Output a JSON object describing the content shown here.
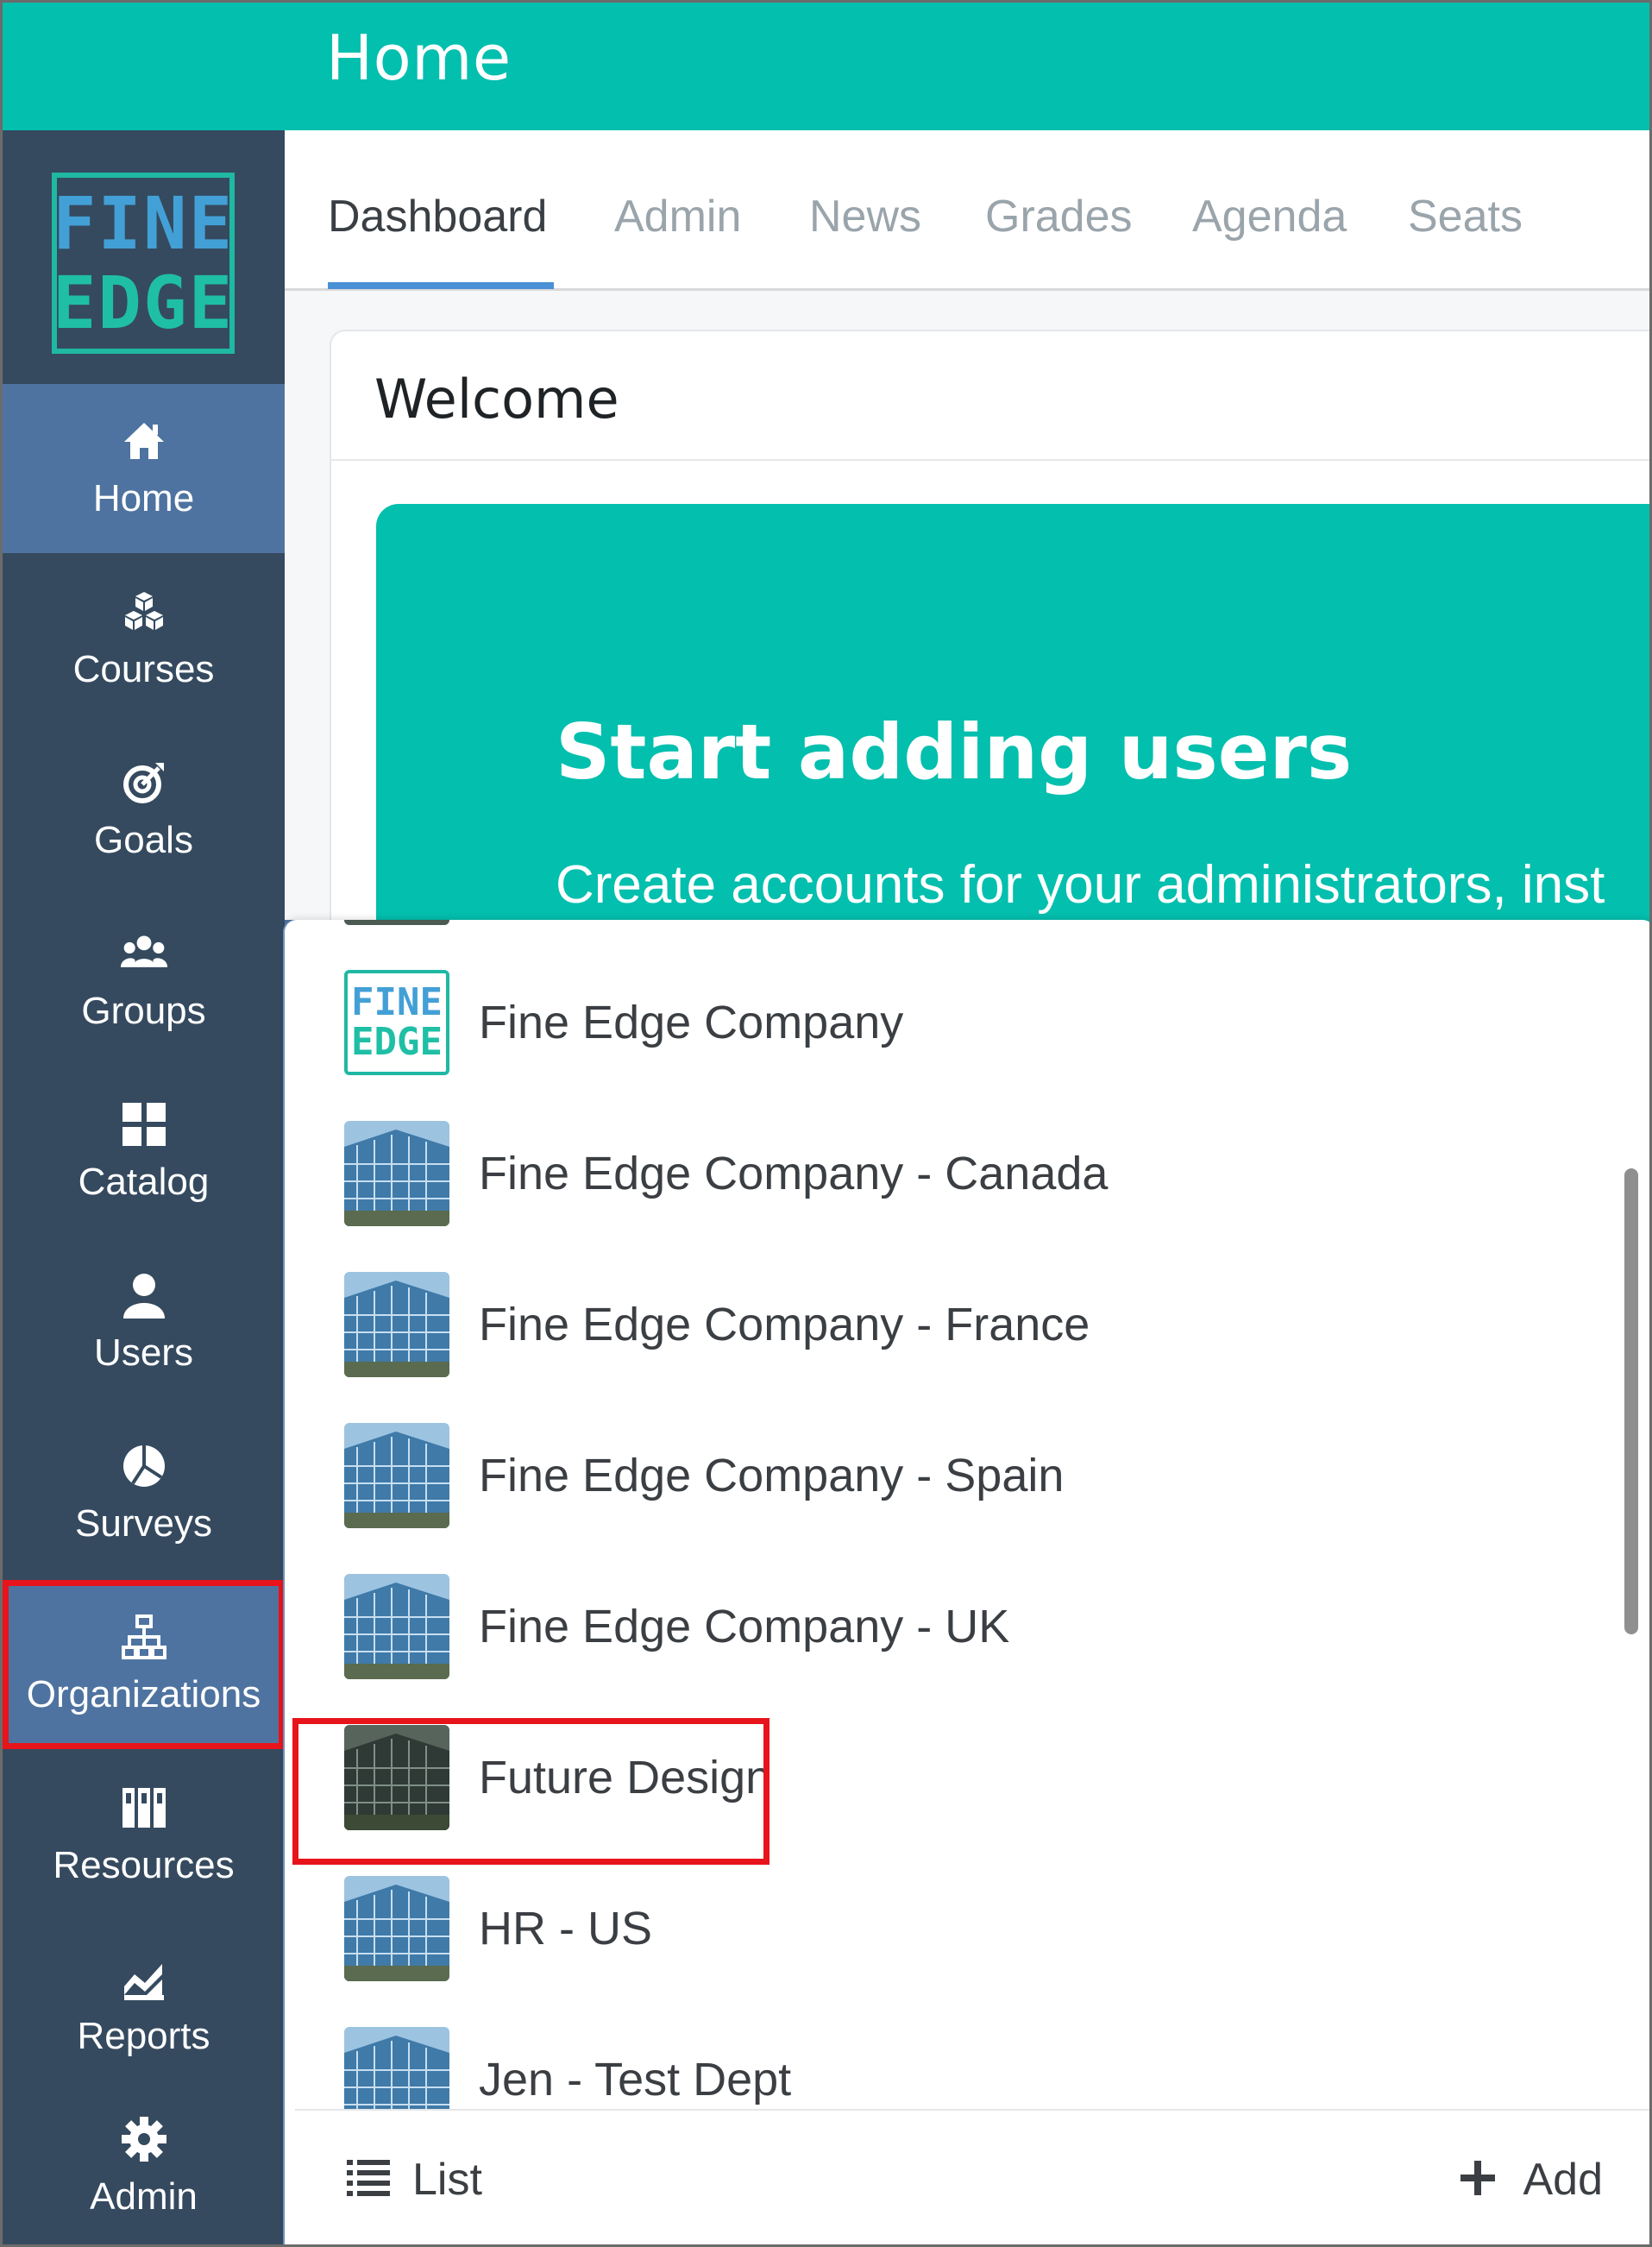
{
  "header": {
    "title": "Home"
  },
  "logo": {
    "line1": "FINE",
    "line2": "EDGE"
  },
  "sidebar": {
    "items": [
      {
        "label": "Home",
        "icon": "home-icon"
      },
      {
        "label": "Courses",
        "icon": "cubes-icon"
      },
      {
        "label": "Goals",
        "icon": "target-icon"
      },
      {
        "label": "Groups",
        "icon": "group-icon"
      },
      {
        "label": "Catalog",
        "icon": "grid-icon"
      },
      {
        "label": "Users",
        "icon": "user-icon"
      },
      {
        "label": "Surveys",
        "icon": "pie-chart-icon"
      },
      {
        "label": "Organizations",
        "icon": "org-chart-icon"
      },
      {
        "label": "Resources",
        "icon": "books-icon"
      },
      {
        "label": "Reports",
        "icon": "area-chart-icon"
      },
      {
        "label": "Admin",
        "icon": "gear-icon"
      }
    ],
    "active": "Home"
  },
  "tabs": [
    {
      "label": "Dashboard"
    },
    {
      "label": "Admin"
    },
    {
      "label": "News"
    },
    {
      "label": "Grades"
    },
    {
      "label": "Agenda"
    },
    {
      "label": "Seats"
    }
  ],
  "welcome": {
    "title": "Welcome",
    "banner_title": "Start adding users",
    "banner_subtitle": "Create accounts for your administrators, inst"
  },
  "organizations": [
    {
      "name": "Fine Edge Company",
      "thumb": "logo"
    },
    {
      "name": "Fine Edge Company - Canada",
      "thumb": "building"
    },
    {
      "name": "Fine Edge Company - France",
      "thumb": "building"
    },
    {
      "name": "Fine Edge Company - Spain",
      "thumb": "building"
    },
    {
      "name": "Fine Edge Company - UK",
      "thumb": "building"
    },
    {
      "name": "Future Design",
      "thumb": "building-dark"
    },
    {
      "name": "HR - US",
      "thumb": "building"
    },
    {
      "name": "Jen - Test Dept",
      "thumb": "building"
    }
  ],
  "footer": {
    "list_label": "List",
    "add_label": "Add"
  },
  "colors": {
    "teal": "#03bfae",
    "sidebar": "#354a5f",
    "active": "#4f73a0",
    "highlight": "#e8141b"
  }
}
